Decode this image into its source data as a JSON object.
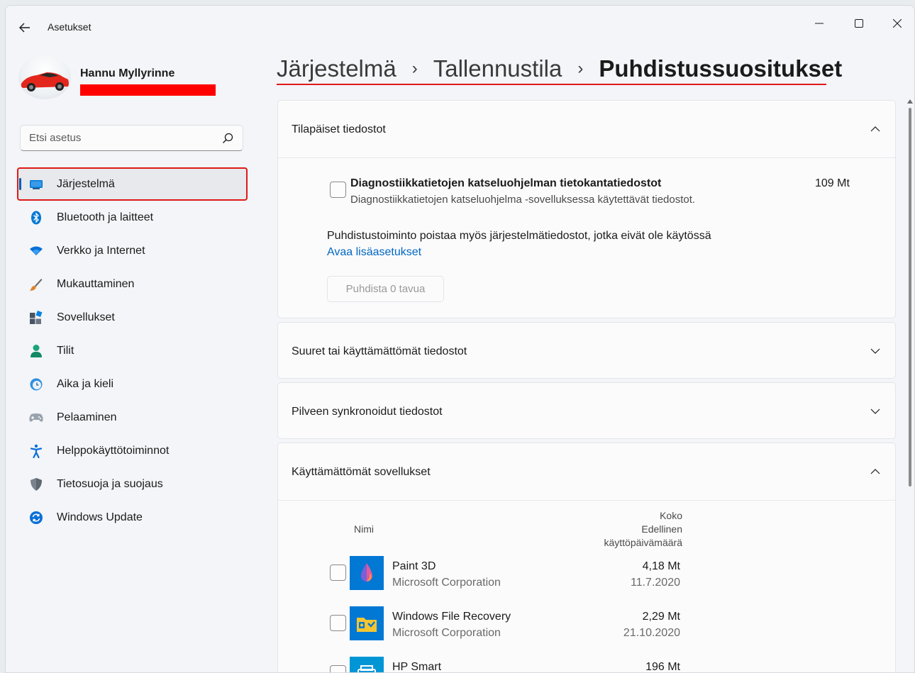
{
  "window": {
    "app_title": "Asetukset"
  },
  "profile": {
    "name": "Hannu Myllyrinne",
    "email": ""
  },
  "search": {
    "placeholder": "Etsi asetus"
  },
  "sidebar": {
    "items": [
      {
        "label": "Järjestelmä",
        "icon": "system-icon",
        "active": true
      },
      {
        "label": "Bluetooth ja laitteet",
        "icon": "bluetooth-icon"
      },
      {
        "label": "Verkko ja Internet",
        "icon": "wifi-icon"
      },
      {
        "label": "Mukauttaminen",
        "icon": "brush-icon"
      },
      {
        "label": "Sovellukset",
        "icon": "apps-icon"
      },
      {
        "label": "Tilit",
        "icon": "person-icon"
      },
      {
        "label": "Aika ja kieli",
        "icon": "clock-globe-icon"
      },
      {
        "label": "Pelaaminen",
        "icon": "gamepad-icon"
      },
      {
        "label": "Helppokäyttötoiminnot",
        "icon": "accessibility-icon"
      },
      {
        "label": "Tietosuoja ja suojaus",
        "icon": "shield-icon"
      },
      {
        "label": "Windows Update",
        "icon": "update-icon"
      }
    ]
  },
  "breadcrumb": {
    "level1": "Järjestelmä",
    "level2": "Tallennustila",
    "current": "Puhdistussuositukset",
    "separator": "›"
  },
  "sections": {
    "temp": {
      "title": "Tilapäiset tiedostot",
      "expanded": true,
      "item_title": "Diagnostiikkatietojen katseluohjelman tietokantatiedostot",
      "item_desc": "Diagnostiikkatietojen katseluohjelma -sovelluksessa käytettävät tiedostot.",
      "item_size": "109 Mt",
      "note": "Puhdistustoiminto poistaa myös järjestelmätiedostot, jotka eivät ole käytössä",
      "link": "Avaa lisäasetukset",
      "button": "Puhdista 0 tavua"
    },
    "large": {
      "title": "Suuret tai käyttämättömät tiedostot",
      "expanded": false
    },
    "cloud": {
      "title": "Pilveen synkronoidut tiedostot",
      "expanded": false
    },
    "unused_apps": {
      "title": "Käyttämättömät sovellukset",
      "expanded": true,
      "col_name": "Nimi",
      "col_size": "Koko",
      "col_last_used_1": "Edellinen",
      "col_last_used_2": "käyttöpäivämäärä",
      "apps": [
        {
          "name": "Paint 3D",
          "publisher": "Microsoft Corporation",
          "size": "4,18 Mt",
          "last_used": "11.7.2020",
          "icon": "paint3d-icon"
        },
        {
          "name": "Windows File Recovery",
          "publisher": "Microsoft Corporation",
          "size": "2,29 Mt",
          "last_used": "21.10.2020",
          "icon": "file-recovery-icon"
        },
        {
          "name": "HP Smart",
          "publisher": "",
          "size": "196 Mt",
          "last_used": "",
          "icon": "hp-smart-icon"
        }
      ]
    }
  },
  "colors": {
    "accent": "#005fb8",
    "link": "#0067c0",
    "annotation_red": "#e01919",
    "app_tile_blue": "#0078d4"
  }
}
